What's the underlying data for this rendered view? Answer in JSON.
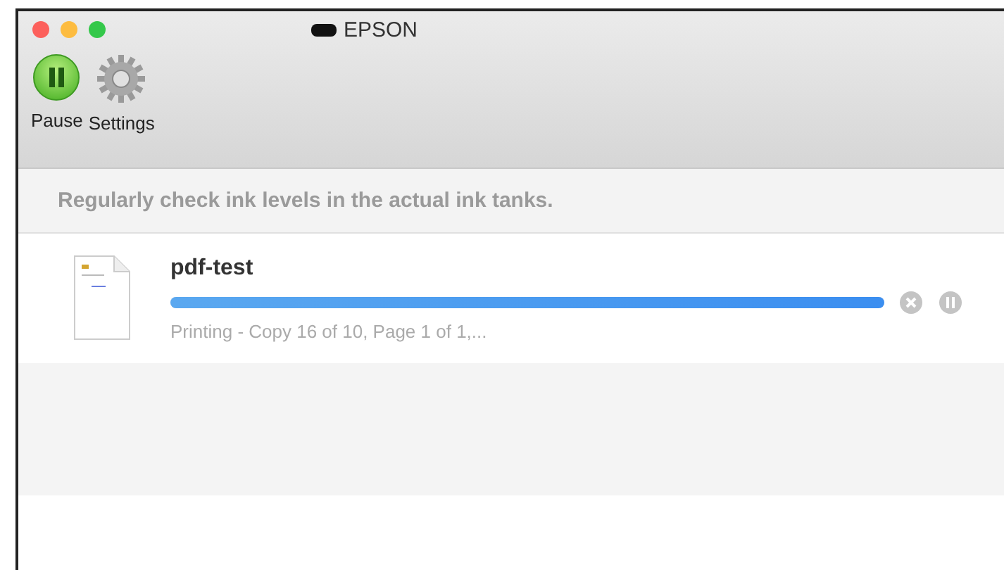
{
  "window": {
    "title": "EPSON"
  },
  "toolbar": [
    {
      "label": "Pause",
      "kind": "pause"
    },
    {
      "label": "Settings",
      "kind": "settings"
    }
  ],
  "notice": "Regularly check ink levels in the actual ink tanks.",
  "jobs": [
    {
      "name": "pdf-test",
      "level": 1,
      "status": "Printing - Copy 16 of 10, Page 1 of 1,..."
    }
  ]
}
